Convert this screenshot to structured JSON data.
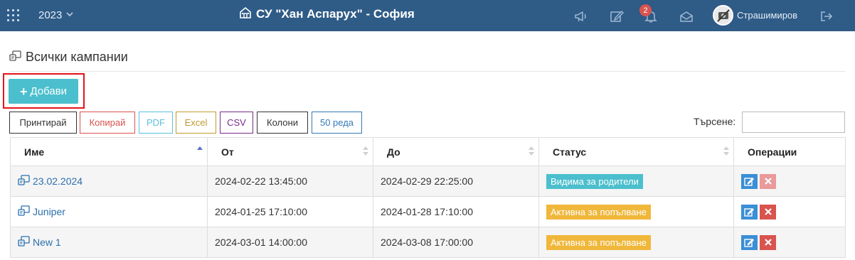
{
  "topbar": {
    "year": "2023",
    "school": "СУ \"Хан Аспарух\" - София",
    "notifications_count": "2",
    "username": "Страшимиров",
    "icons": [
      "apps-grid-icon",
      "chevron-down-icon",
      "school-icon",
      "megaphone-icon",
      "edit-icon",
      "bell-icon",
      "envelope-icon",
      "avatar",
      "logout-icon"
    ]
  },
  "page": {
    "title": "Всички кампании",
    "add_label": "Добави"
  },
  "toolbar": {
    "buttons": [
      {
        "label": "Принтирай",
        "color": "#333333"
      },
      {
        "label": "Копирай",
        "color": "#d9534f"
      },
      {
        "label": "PDF",
        "color": "#5bc0de"
      },
      {
        "label": "Excel",
        "color": "#c09a2c"
      },
      {
        "label": "CSV",
        "color": "#7a2a8a"
      },
      {
        "label": "Колони",
        "color": "#333333"
      },
      {
        "label": "50 реда",
        "color": "#337ab7"
      }
    ],
    "search_label": "Търсене:",
    "search_value": ""
  },
  "table": {
    "columns": [
      "Име",
      "От",
      "До",
      "Статус",
      "Операции"
    ],
    "sorted_column": "Име",
    "rows": [
      {
        "name": "23.02.2024",
        "from": "2024-02-22 13:45:00",
        "to": "2024-02-29 22:25:00",
        "status": "Видима за родители",
        "status_color": "#4bbfcd"
      },
      {
        "name": "Juniper",
        "from": "2024-01-25 17:10:00",
        "to": "2024-01-28 17:10:00",
        "status": "Активна за попълване",
        "status_color": "#f0b73a"
      },
      {
        "name": "New 1",
        "from": "2024-03-01 14:00:00",
        "to": "2024-03-08 17:00:00",
        "status": "Активна за попълване",
        "status_color": "#f0b73a"
      }
    ]
  },
  "colors": {
    "topbar": "#2f5b87",
    "accent": "#4bbfcd",
    "edit": "#3a8fd6",
    "delete": "#d9534f",
    "delete_disabled": "#e99a9a"
  }
}
